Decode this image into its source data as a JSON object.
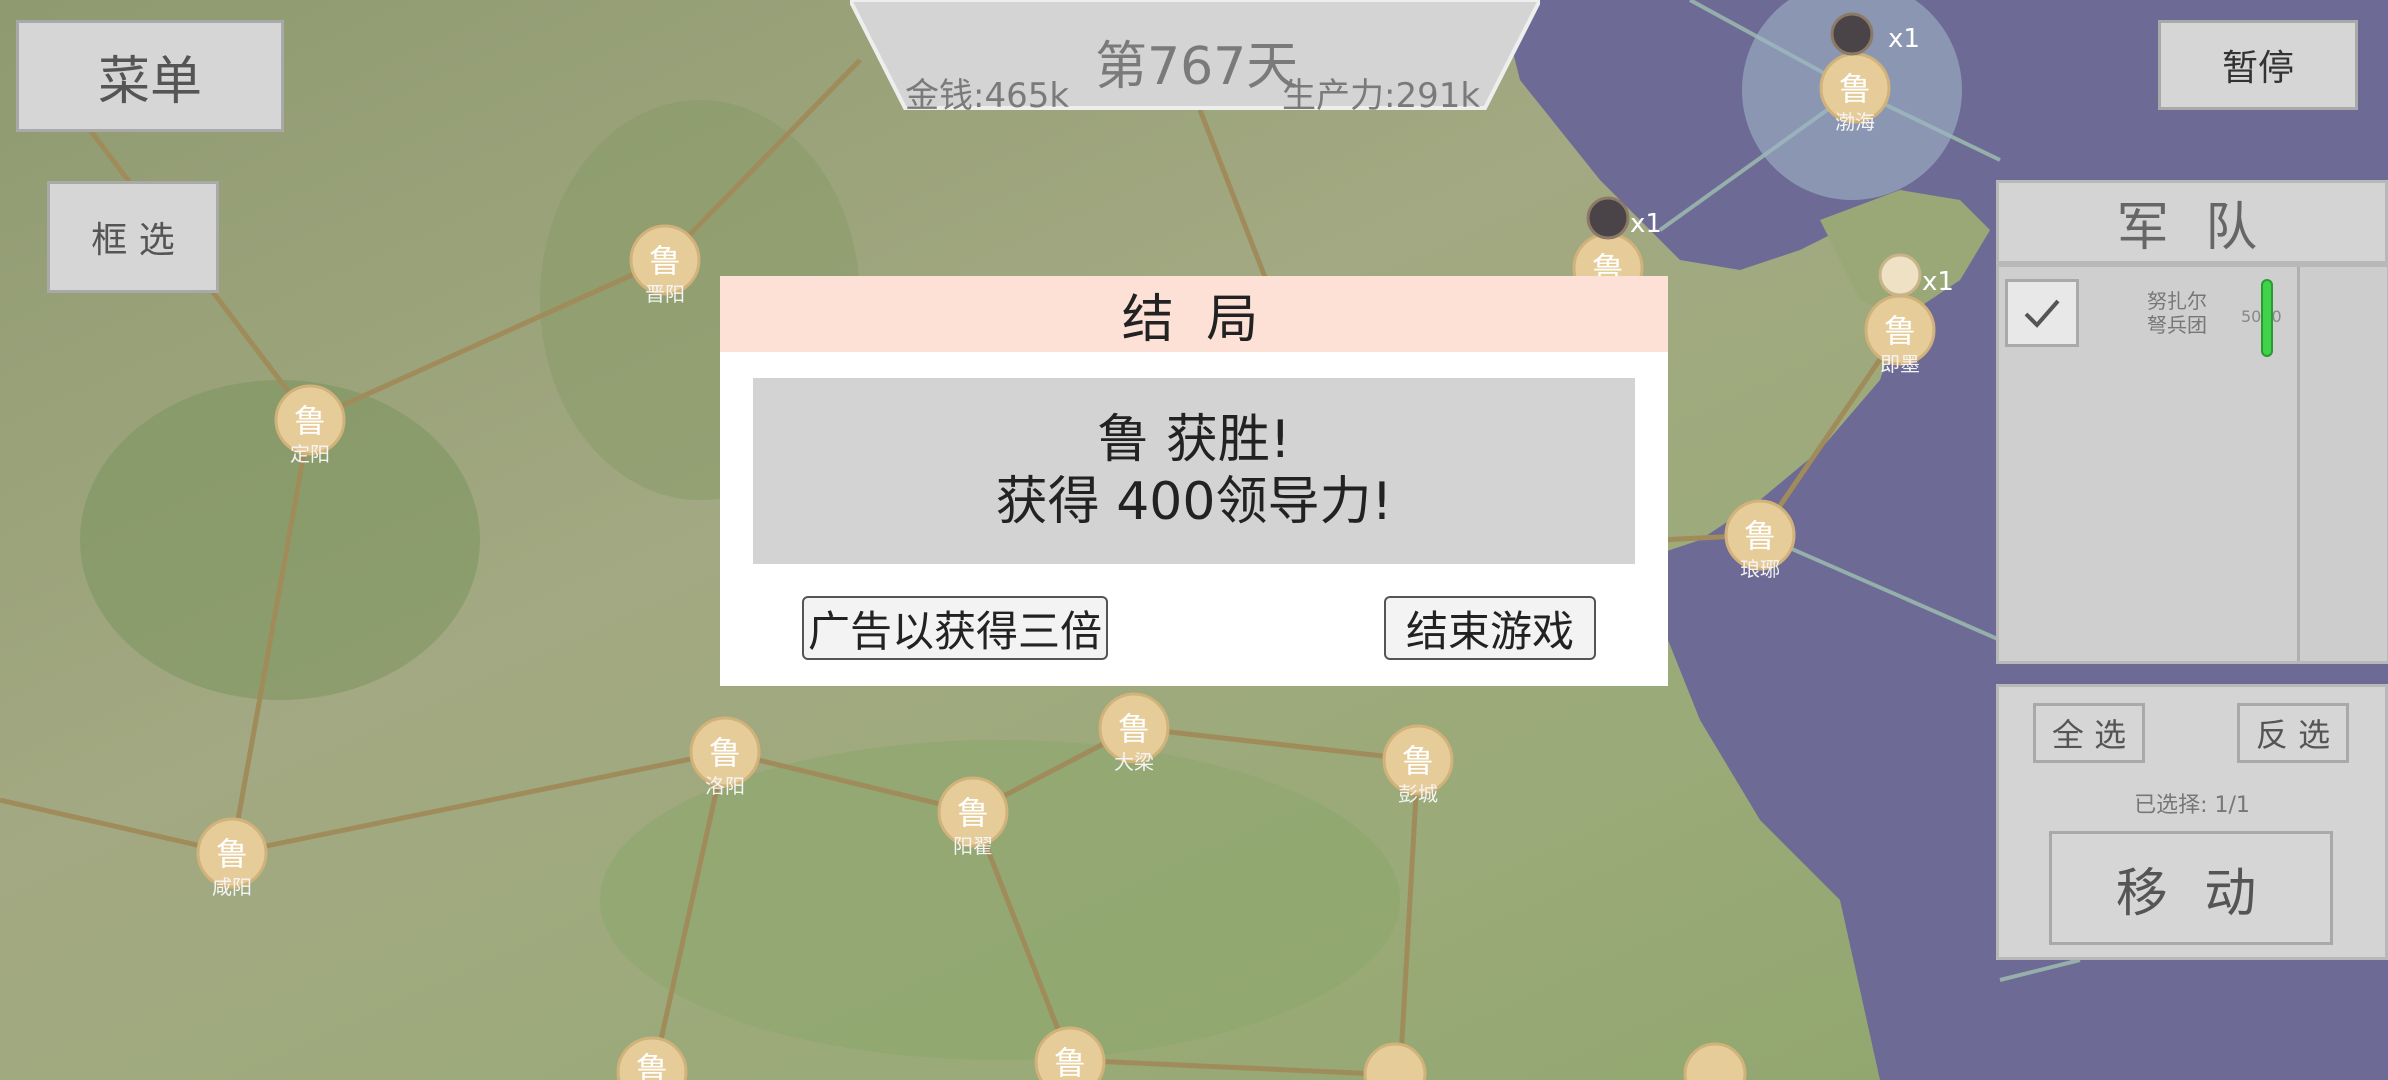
{
  "hud": {
    "day": "第767天",
    "money": "金钱:465k",
    "production": "生产力:291k"
  },
  "buttons": {
    "menu": "菜单",
    "box_select": "框 选",
    "pause": "暂停"
  },
  "map": {
    "faction_char": "鲁",
    "cities": [
      {
        "name": "晋阳"
      },
      {
        "name": "定阳"
      },
      {
        "name": "咸阳"
      },
      {
        "name": "洛阳"
      },
      {
        "name": "阳翟"
      },
      {
        "name": "大梁"
      },
      {
        "name": "彭城"
      },
      {
        "name": "琅琊"
      },
      {
        "name": "即墨"
      },
      {
        "name": "渤海"
      }
    ],
    "unit_counts": [
      "x1",
      "x1",
      "x1"
    ],
    "colors": {
      "sea": "#6e6a96",
      "road": "#a08c5a",
      "node": "#e6cc99"
    }
  },
  "modal": {
    "title": "结 局",
    "line1": "鲁 获胜!",
    "line2": "获得 400领导力!",
    "ad_button": "广告以获得三倍",
    "end_button": "结束游戏"
  },
  "army": {
    "title": "军 队",
    "unit_name_1": "努扎尔",
    "unit_name_2": "弩兵团",
    "unit_strength": "5000",
    "select_all": "全 选",
    "invert_select": "反 选",
    "selected": "已选择: 1/1",
    "move": "移 动"
  }
}
